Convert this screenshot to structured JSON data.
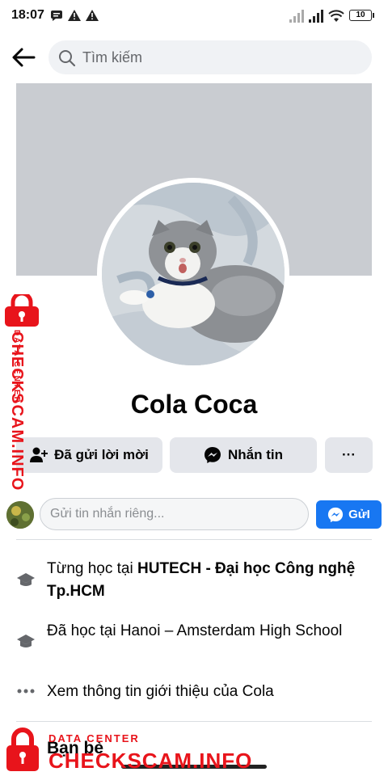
{
  "status_bar": {
    "time": "18:07",
    "battery": "10"
  },
  "search": {
    "placeholder": "Tìm kiếm"
  },
  "profile": {
    "name": "Cola Coca"
  },
  "actions": {
    "add_friend": "Đã gửi lời mời",
    "message": "Nhắn tin",
    "more": "···"
  },
  "message_box": {
    "placeholder": "Gửi tin nhắn riêng...",
    "send": "GửI"
  },
  "info": {
    "school1_prefix": "Từng học tại ",
    "school1_name": "HUTECH - Đại học Công nghệ Tp.HCM",
    "school2": "Đã học tại Hanoi – Amsterdam High School",
    "about": "Xem thông tin giới thiệu của Cola"
  },
  "friends_heading": "Bạn bè",
  "watermark": {
    "line1": "DATA CENTER",
    "line2": "CHECKSCAM.INFO"
  },
  "colors": {
    "accent": "#1877f2",
    "watermark": "#e8141b",
    "cover": "#c9ccd1"
  }
}
